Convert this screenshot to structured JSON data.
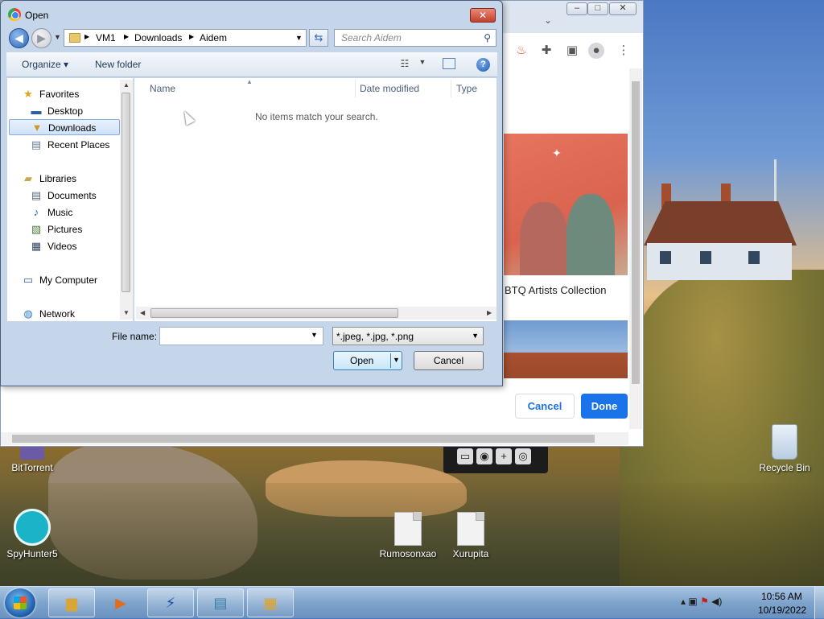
{
  "dialog": {
    "title": "Open",
    "address": {
      "crumbs": [
        "VM1",
        "Downloads",
        "Aidem"
      ]
    },
    "search_placeholder": "Search Aidem",
    "toolbar": {
      "organize": "Organize",
      "new_folder": "New folder"
    },
    "nav": {
      "favorites": "Favorites",
      "desktop": "Desktop",
      "downloads": "Downloads",
      "recent": "Recent Places",
      "libraries": "Libraries",
      "documents": "Documents",
      "music": "Music",
      "pictures": "Pictures",
      "videos": "Videos",
      "my_computer": "My Computer",
      "network": "Network"
    },
    "columns": {
      "name": "Name",
      "date_modified": "Date modified",
      "type": "Type"
    },
    "empty_message": "No items match your search.",
    "file_name_label": "File name:",
    "file_name_value": "",
    "filter": "*.jpeg, *.jpg, *.png",
    "open_button": "Open",
    "cancel_button": "Cancel"
  },
  "browser": {
    "card_title": "BTQ Artists Collection",
    "cancel_button": "Cancel",
    "done_button": "Done"
  },
  "desktop": {
    "icons": {
      "bittorrent": "BitTorrent",
      "recycle_bin": "Recycle Bin",
      "spyhunter": "SpyHunter5",
      "rumosonxao": "Rumosonxao",
      "xurupita": "Xurupita"
    }
  },
  "taskbar": {
    "time": "10:56 AM",
    "date": "10/19/2022"
  },
  "colors": {
    "accent_blue": "#1a73e8",
    "dialog_frame": "#c6d6ea"
  }
}
